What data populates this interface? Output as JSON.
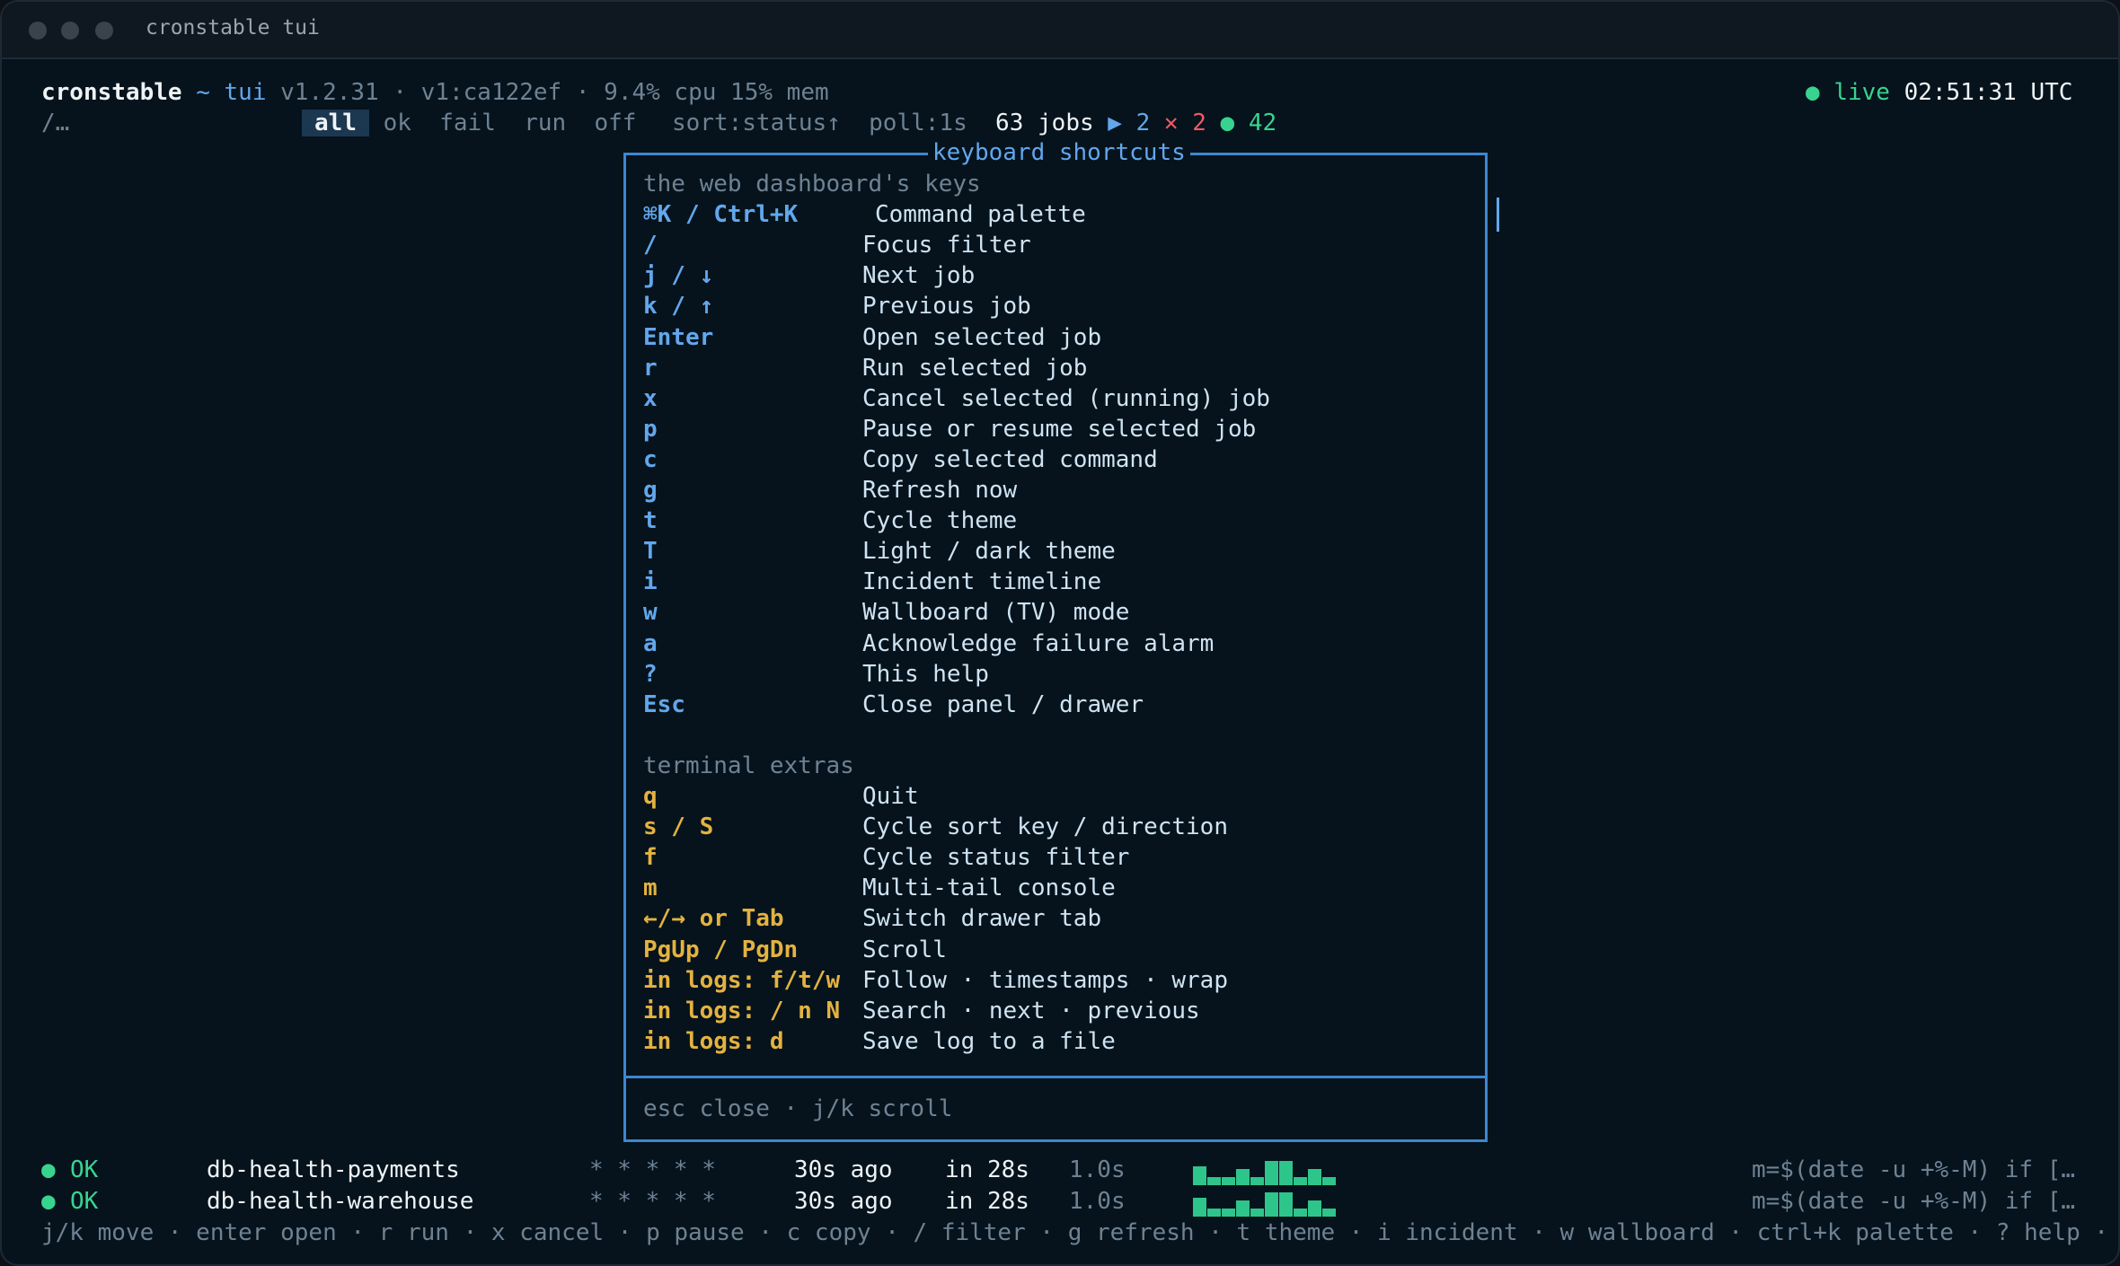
{
  "window": {
    "title": "cronstable tui"
  },
  "header": {
    "app": "cronstable",
    "sep": "~",
    "mode": "tui",
    "meta": "v1.2.31 · v1:ca122ef · 9.4% cpu 15% mem",
    "live_label": "live",
    "clock": "02:51:31 UTC",
    "accent_color": "#62a7ec",
    "live_color": "#38d48f"
  },
  "filterbar": {
    "filter_prompt": "/…",
    "filters": [
      "all",
      "ok",
      "fail",
      "run",
      "off"
    ],
    "active_filter": "all",
    "sort": "sort:status↑",
    "poll": "poll:1s",
    "jobs_label": "63 jobs",
    "running_glyph": "▶",
    "running": "2",
    "failed_glyph": "✕",
    "failed": "2",
    "ok_glyph": "●",
    "ok": "42"
  },
  "modal": {
    "title": "keyboard shortcuts",
    "section1_title": "the web dashboard's keys",
    "section1": [
      {
        "key": "⌘K / Ctrl+K",
        "desc": "Command palette"
      },
      {
        "key": "/",
        "desc": "Focus filter"
      },
      {
        "key": "j / ↓",
        "desc": "Next job"
      },
      {
        "key": "k / ↑",
        "desc": "Previous job"
      },
      {
        "key": "Enter",
        "desc": "Open selected job"
      },
      {
        "key": "r",
        "desc": "Run selected job"
      },
      {
        "key": "x",
        "desc": "Cancel selected (running) job"
      },
      {
        "key": "p",
        "desc": "Pause or resume selected job"
      },
      {
        "key": "c",
        "desc": "Copy selected command"
      },
      {
        "key": "g",
        "desc": "Refresh now"
      },
      {
        "key": "t",
        "desc": "Cycle theme"
      },
      {
        "key": "T",
        "desc": "Light / dark theme"
      },
      {
        "key": "i",
        "desc": "Incident timeline"
      },
      {
        "key": "w",
        "desc": "Wallboard (TV) mode"
      },
      {
        "key": "a",
        "desc": "Acknowledge failure alarm"
      },
      {
        "key": "?",
        "desc": "This help"
      },
      {
        "key": "Esc",
        "desc": "Close panel / drawer"
      }
    ],
    "section2_title": "terminal extras",
    "section2": [
      {
        "key": "q",
        "desc": "Quit"
      },
      {
        "key": "s / S",
        "desc": "Cycle sort key / direction"
      },
      {
        "key": "f",
        "desc": "Cycle status filter"
      },
      {
        "key": "m",
        "desc": "Multi-tail console"
      },
      {
        "key": "←/→ or Tab",
        "desc": "Switch drawer tab"
      },
      {
        "key": "PgUp / PgDn",
        "desc": "Scroll"
      },
      {
        "key": "in logs: f/t/w",
        "desc": "Follow · timestamps · wrap"
      },
      {
        "key": "in logs: / n N",
        "desc": "Search · next · previous"
      },
      {
        "key": "in logs: d",
        "desc": "Save log to a file"
      }
    ],
    "footer": "esc close · j/k scroll"
  },
  "jobs": [
    {
      "status": "OK",
      "name": "db-health-payments",
      "schedule": "* * * * *",
      "last": "30s ago",
      "next": "in 28s",
      "duration": "1.0s",
      "history": [
        0.7,
        0.3,
        0.3,
        0.6,
        0.3,
        0.9,
        0.9,
        0.3,
        0.6,
        0.3
      ],
      "command": "m=$(date -u +%-M) if […"
    },
    {
      "status": "OK",
      "name": "db-health-warehouse",
      "schedule": "* * * * *",
      "last": "30s ago",
      "next": "in 28s",
      "duration": "1.0s",
      "history": [
        0.7,
        0.3,
        0.3,
        0.6,
        0.3,
        0.9,
        0.9,
        0.3,
        0.6,
        0.3
      ],
      "command": "m=$(date -u +%-M) if […"
    }
  ],
  "keybar": "j/k move · enter open · r run · x cancel · p pause · c copy · / filter · g refresh · t theme · i incident · w wallboard · ctrl+k palette · ? help · …"
}
